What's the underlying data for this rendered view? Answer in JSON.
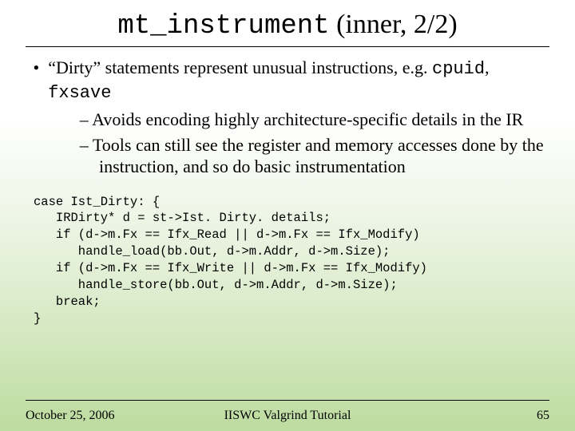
{
  "title": {
    "code_part": "mt_instrument",
    "rest": " (inner, 2/2)"
  },
  "bullet1": {
    "pre": "“Dirty” statements represent unusual instructions, e.g. ",
    "code1": "cpuid",
    "mid": ", ",
    "code2": "fxsave"
  },
  "sub1": "Avoids encoding highly architecture-specific details in the IR",
  "sub2": "Tools can still see the register and memory accesses done by the instruction, and so do basic instrumentation",
  "code": "case Ist_Dirty: {\n   IRDirty* d = st->Ist. Dirty. details;\n   if (d->m.Fx == Ifx_Read || d->m.Fx == Ifx_Modify)\n      handle_load(bb.Out, d->m.Addr, d->m.Size);\n   if (d->m.Fx == Ifx_Write || d->m.Fx == Ifx_Modify)\n      handle_store(bb.Out, d->m.Addr, d->m.Size);\n   break;\n}",
  "footer": {
    "date": "October 25, 2006",
    "center": "IISWC Valgrind Tutorial",
    "pagenum": "65"
  }
}
